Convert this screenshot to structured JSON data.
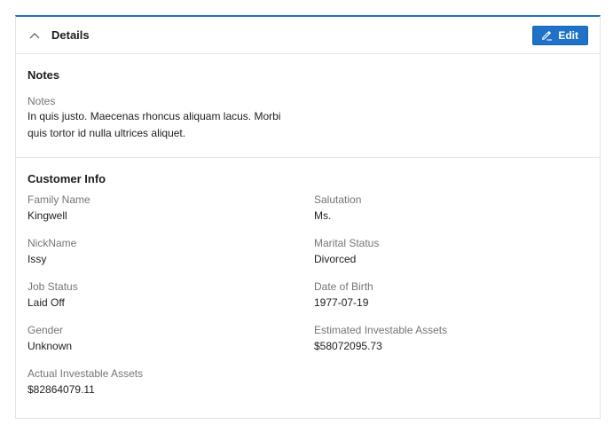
{
  "card": {
    "title": "Details",
    "edit_label": "Edit"
  },
  "notes": {
    "section_title": "Notes",
    "field_label": "Notes",
    "field_value": "In quis justo. Maecenas rhoncus aliquam lacus. Morbi quis tortor id nulla ultrices aliquet."
  },
  "customer_info": {
    "section_title": "Customer Info",
    "fields": [
      {
        "label": "Family Name",
        "value": "Kingwell"
      },
      {
        "label": "Salutation",
        "value": "Ms."
      },
      {
        "label": "NickName",
        "value": "Issy"
      },
      {
        "label": "Marital Status",
        "value": "Divorced"
      },
      {
        "label": "Job Status",
        "value": "Laid Off"
      },
      {
        "label": "Date of Birth",
        "value": "1977-07-19"
      },
      {
        "label": "Gender",
        "value": "Unknown"
      },
      {
        "label": "Estimated Investable Assets",
        "value": "$58072095.73"
      },
      {
        "label": "Actual Investable Assets",
        "value": "$82864079.11"
      }
    ]
  },
  "colors": {
    "accent": "#1f72c7",
    "label": "#757575",
    "text": "#1e1e1e",
    "border": "#e3e3e3"
  },
  "icons": {
    "collapse": "chevron-up-icon",
    "edit": "pencil-icon"
  }
}
